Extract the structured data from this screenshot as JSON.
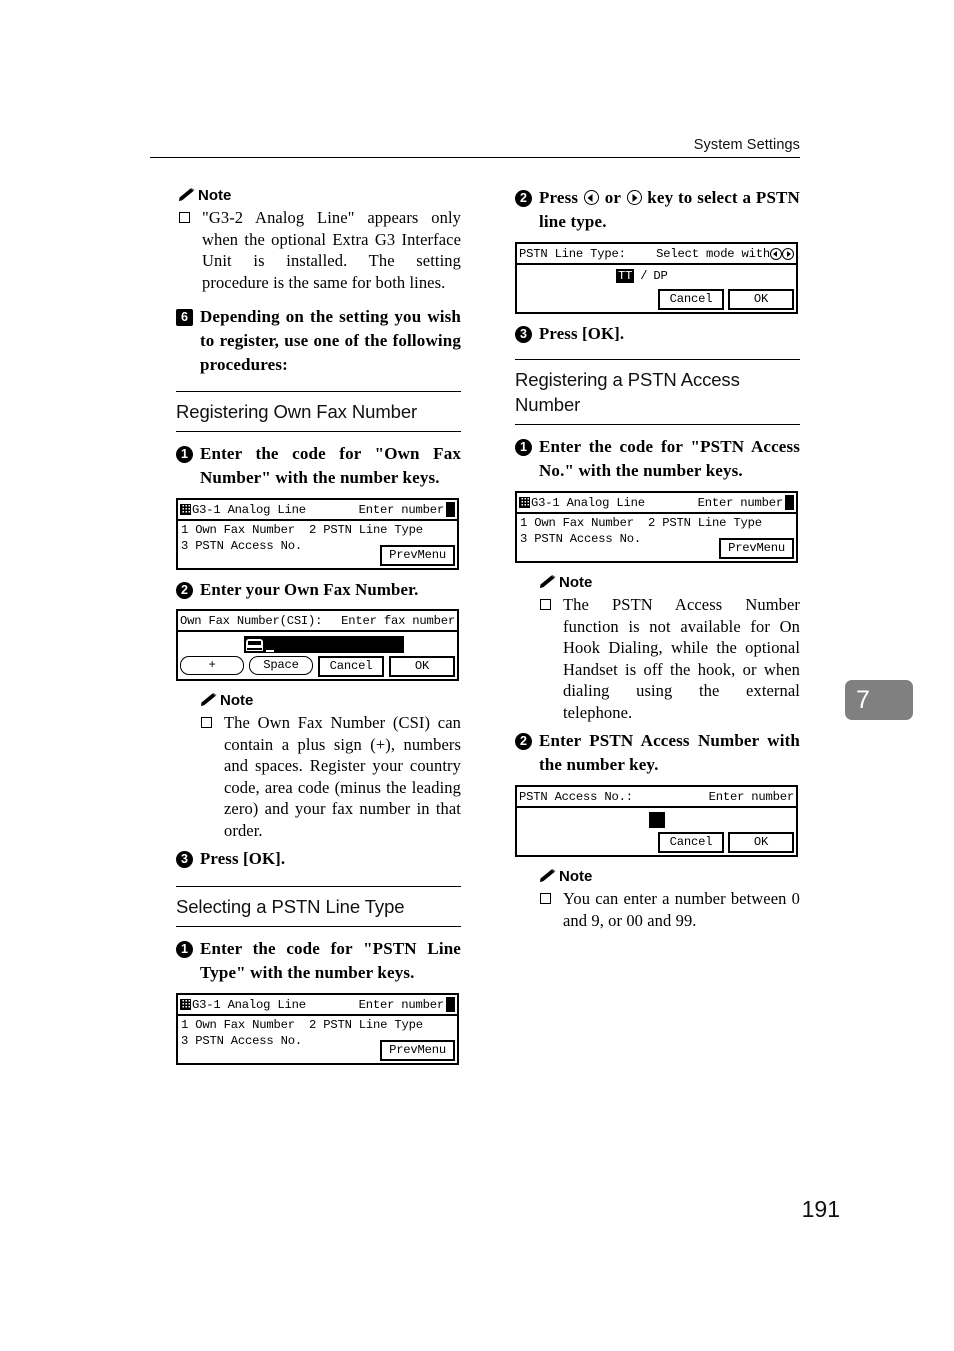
{
  "header": {
    "title": "System Settings"
  },
  "folio": {
    "page_number": "191"
  },
  "chapter_tab": {
    "number": "7"
  },
  "left_column": {
    "note1": {
      "heading": "Note",
      "items": [
        "\"G3-2 Analog Line\" appears only when the optional Extra G3 Interface Unit is installed. The setting procedure is the same for both lines."
      ]
    },
    "step6": {
      "marker": "6",
      "text": "Depending on the setting you wish to register, use one of the following procedures:"
    },
    "section_own_fax": {
      "title": "Registering Own Fax Number",
      "step1": {
        "marker": "1",
        "text": "Enter the code for \"Own Fax Number\" with the number keys."
      },
      "lcd1": {
        "title_left": "G3-1 Analog Line",
        "title_right": "Enter number",
        "row1_col1": "1 Own Fax Number",
        "row1_col2": "2 PSTN Line Type",
        "row2_col1": "3 PSTN Access No.",
        "softkey": "PrevMenu"
      },
      "step2": {
        "marker": "2",
        "text": "Enter your Own Fax Number."
      },
      "lcd2": {
        "title_left": "Own Fax Number(CSI):",
        "title_right": "Enter fax number",
        "key_plus": "+",
        "key_space": "Space",
        "key_cancel": "Cancel",
        "key_ok": "OK"
      },
      "note2": {
        "heading": "Note",
        "items": [
          "The Own Fax Number (CSI) can contain a plus sign (+), numbers and spaces. Register your country code, area code (minus the leading zero) and your fax number in that order."
        ]
      },
      "step3": {
        "marker": "3",
        "text": "Press [OK]."
      }
    },
    "section_pstn_line_type": {
      "title": "Selecting a PSTN Line Type",
      "step1": {
        "marker": "1",
        "text": "Enter the code for \"PSTN Line Type\" with the number keys."
      },
      "lcd1": {
        "title_left": "G3-1 Analog Line",
        "title_right": "Enter number",
        "row1_col1": "1 Own Fax Number",
        "row1_col2": "2 PSTN Line Type",
        "row2_col1": "3 PSTN Access No.",
        "softkey": "PrevMenu"
      }
    }
  },
  "right_column": {
    "step2": {
      "marker": "2",
      "text_before": "Press",
      "text_middle": "or",
      "text_after": "key to select a PSTN line type."
    },
    "lcd_line_type": {
      "title_left": "PSTN Line Type:",
      "title_right": "Select mode with",
      "option_selected": "TT",
      "option_separator": "/",
      "option_other": "DP",
      "key_cancel": "Cancel",
      "key_ok": "OK"
    },
    "step3": {
      "marker": "3",
      "text": "Press [OK]."
    },
    "section_pstn_access": {
      "title": "Registering a PSTN Access Number",
      "step1": {
        "marker": "1",
        "text": "Enter the code for \"PSTN Access No.\" with the number keys."
      },
      "lcd1": {
        "title_left": "G3-1 Analog Line",
        "title_right": "Enter number",
        "row1_col1": "1 Own Fax Number",
        "row1_col2": "2 PSTN Line Type",
        "row2_col1": "3 PSTN Access No.",
        "softkey": "PrevMenu"
      },
      "note1": {
        "heading": "Note",
        "items": [
          "The PSTN Access Number function is not available for On Hook Dialing, while the optional Handset is off the hook, or when dialing using the external telephone."
        ]
      },
      "step2": {
        "marker": "2",
        "text": "Enter PSTN Access Number with the number key."
      },
      "lcd2": {
        "title_left": "PSTN Access No.:",
        "title_right": "Enter number",
        "key_cancel": "Cancel",
        "key_ok": "OK"
      },
      "note2": {
        "heading": "Note",
        "items": [
          "You can enter a number between 0 and 9, or 00 and 99."
        ]
      }
    }
  }
}
